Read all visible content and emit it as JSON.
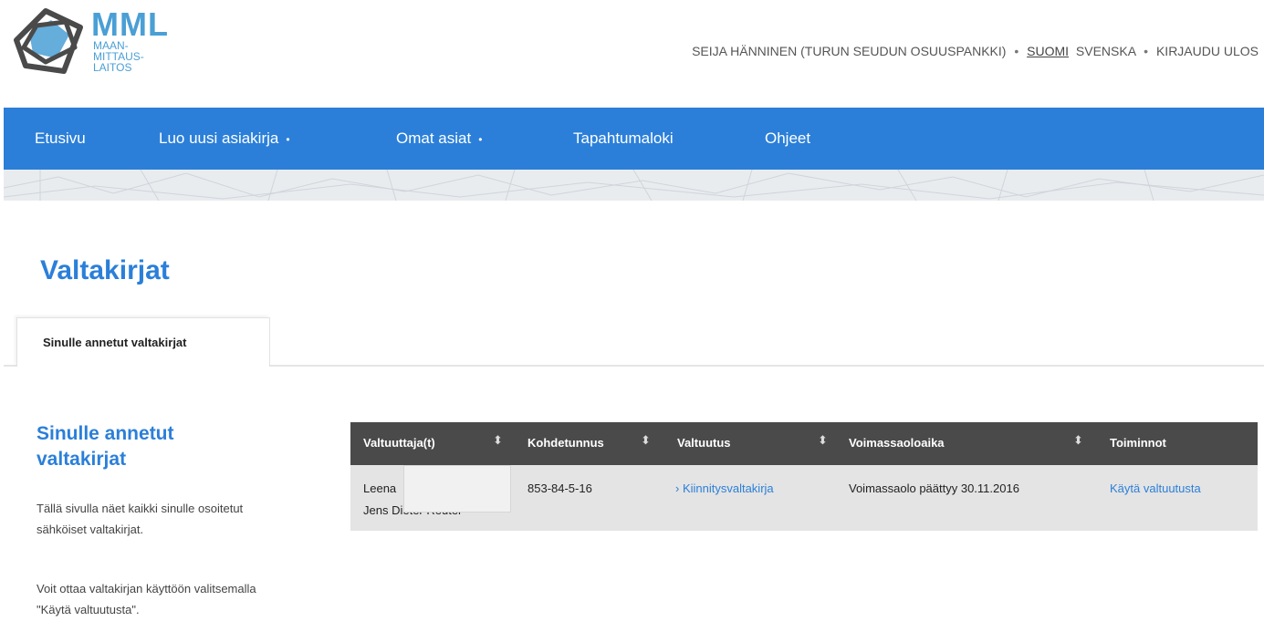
{
  "header": {
    "logo_title": "MML",
    "logo_sub": [
      "MAAN-",
      "MITTAUS-",
      "LAITOS"
    ],
    "user": "SEIJA HÄNNINEN (TURUN SEUDUN OSUUSPANKKI)",
    "lang_fi": "SUOMI",
    "lang_sv": "SVENSKA",
    "logout": "KIRJAUDU ULOS",
    "separator": "•"
  },
  "nav": {
    "items": [
      {
        "label": "Etusivu"
      },
      {
        "label": "Luo uusi asiakirja"
      },
      {
        "label": "Omat asiat"
      },
      {
        "label": "Tapahtumaloki"
      },
      {
        "label": "Ohjeet"
      }
    ],
    "caret": "•"
  },
  "page": {
    "title": "Valtakirjat",
    "tab_active": "Sinulle annetut valtakirjat"
  },
  "sidebar": {
    "title": "Sinulle annetut valtakirjat",
    "p1": "Tällä sivulla näet kaikki sinulle osoitetut sähköiset valtakirjat.",
    "p2": "Voit ottaa valtakirjan käyttöön valitsemalla \"Käytä valtuutusta\"."
  },
  "table": {
    "columns": [
      "Valtuuttaja(t)",
      "Kohdetunnus",
      "Valtuutus",
      "Voimassaoloaika",
      "Toiminnot"
    ],
    "sort_icon": "⬍",
    "rows": [
      {
        "valtuuttaja_line1": "Leena",
        "valtuuttaja_line2": "Jens Dieter Reuter",
        "kohdetunnus": "853-84-5-16",
        "valtuutus": "› Kiinnitysvaltakirja",
        "voimassaoloaika": "Voimassaolo päättyy 30.11.2016",
        "toiminnot": "Käytä valtuutusta"
      }
    ]
  },
  "colors": {
    "brand_blue": "#2b7fd9",
    "table_header": "#4a4a4a",
    "row_bg": "#e4e4e4"
  }
}
